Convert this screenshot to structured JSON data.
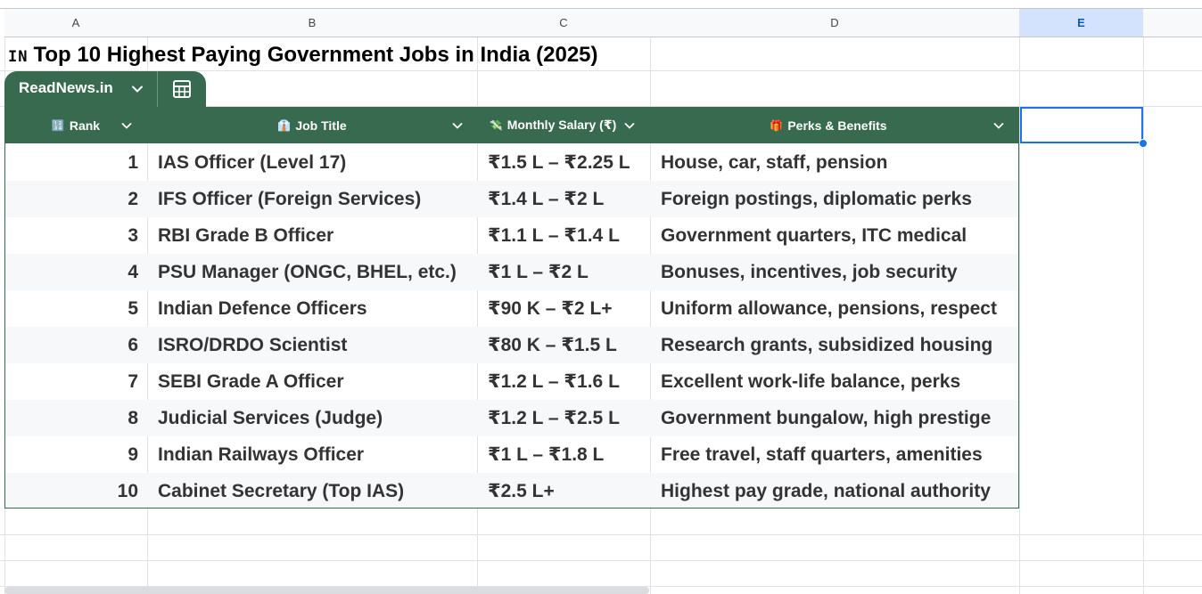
{
  "columns": [
    "A",
    "B",
    "C",
    "D",
    "E"
  ],
  "title": {
    "flag": "IN",
    "text": "Top 10 Highest Paying Government Jobs in India (2025)"
  },
  "table": {
    "name": "ReadNews.in",
    "header_color": "#386a50",
    "headers": [
      {
        "emoji": "🔢",
        "label": "Rank"
      },
      {
        "emoji": "👔",
        "label": "Job Title"
      },
      {
        "emoji": "💸",
        "label": "Monthly Salary (₹)"
      },
      {
        "emoji": "🎁",
        "label": "Perks & Benefits"
      }
    ],
    "rows": [
      {
        "rank": "1",
        "job": "IAS Officer (Level 17)",
        "salary": "₹1.5 L – ₹2.25 L",
        "perks": "House, car, staff, pension"
      },
      {
        "rank": "2",
        "job": "IFS Officer (Foreign Services)",
        "salary": "₹1.4 L – ₹2 L",
        "perks": "Foreign postings, diplomatic perks"
      },
      {
        "rank": "3",
        "job": "RBI Grade B Officer",
        "salary": "₹1.1 L – ₹1.4 L",
        "perks": "Government quarters, ITC medical"
      },
      {
        "rank": "4",
        "job": "PSU Manager (ONGC, BHEL, etc.)",
        "salary": "₹1 L – ₹2 L",
        "perks": "Bonuses, incentives, job security"
      },
      {
        "rank": "5",
        "job": "Indian Defence Officers",
        "salary": "₹90 K – ₹2 L+",
        "perks": "Uniform allowance, pensions, respect"
      },
      {
        "rank": "6",
        "job": "ISRO/DRDO Scientist",
        "salary": "₹80 K – ₹1.5 L",
        "perks": "Research grants, subsidized housing"
      },
      {
        "rank": "7",
        "job": "SEBI Grade A Officer",
        "salary": "₹1.2 L – ₹1.6 L",
        "perks": "Excellent work-life balance, perks"
      },
      {
        "rank": "8",
        "job": "Judicial Services (Judge)",
        "salary": "₹1.2 L – ₹2.5 L",
        "perks": "Government bungalow, high prestige"
      },
      {
        "rank": "9",
        "job": "Indian Railways Officer",
        "salary": "₹1 L – ₹1.8 L",
        "perks": "Free travel, staff quarters, amenities"
      },
      {
        "rank": "10",
        "job": "Cabinet Secretary (Top IAS)",
        "salary": "₹2.5 L+",
        "perks": "Highest pay grade, national authority"
      }
    ]
  },
  "selected_column": "E",
  "accent_color": "#1a73e8"
}
